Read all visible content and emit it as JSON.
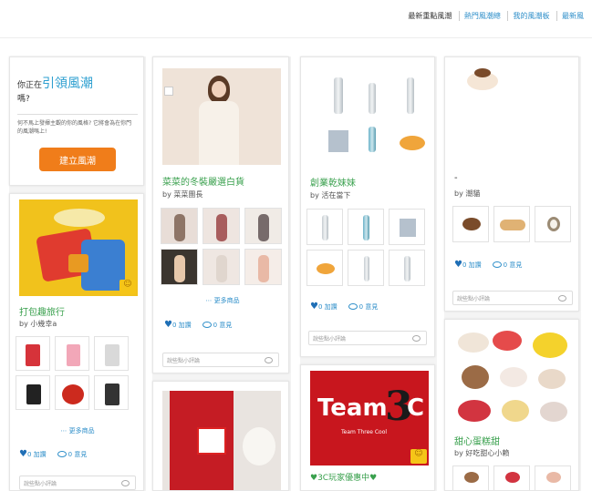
{
  "nav": {
    "items": [
      "最新重點風潮",
      "熱門風潮總",
      "我的風潮板",
      "最新風"
    ]
  },
  "promo": {
    "question_prefix": "你正在",
    "question_highlight": "引領風潮",
    "question_suffix": "嗎?",
    "desc": "何不馬上發揮主觀的你的風格? 它將會為在你門的風潮嗎上!",
    "button": "建立風潮",
    "accent_color": "#f07d1a"
  },
  "cards": [
    {
      "title": "打包趣旅行",
      "by": "by 小幾幸a",
      "more": "更多商品",
      "likes": "0 加讚",
      "comments": "0 意見",
      "comment_placeholder": "說些點小評論"
    },
    {
      "title": "菜菜的冬裝嚴選白貨",
      "by": "by 菜菜團長",
      "more": "更多商品",
      "likes": "0 加讚",
      "comments": "0 意見",
      "comment_placeholder": "說些點小評論"
    },
    {
      "title": "創業乾妹妹",
      "by": "by 活在當下",
      "likes": "0 加讚",
      "comments": "0 意見",
      "comment_placeholder": "說些點小評論"
    },
    {
      "title": "-",
      "by": "by 潮貓",
      "likes": "0 加讚",
      "comments": "0 意見",
      "comment_placeholder": "說些點小評論"
    },
    {
      "title": "3C玩家優惠中",
      "logo_text": "Team",
      "logo_small": "Team Three Cool"
    },
    {
      "title": "甜心蛋糕甜",
      "by": "by 好吃甜心小賴"
    }
  ]
}
